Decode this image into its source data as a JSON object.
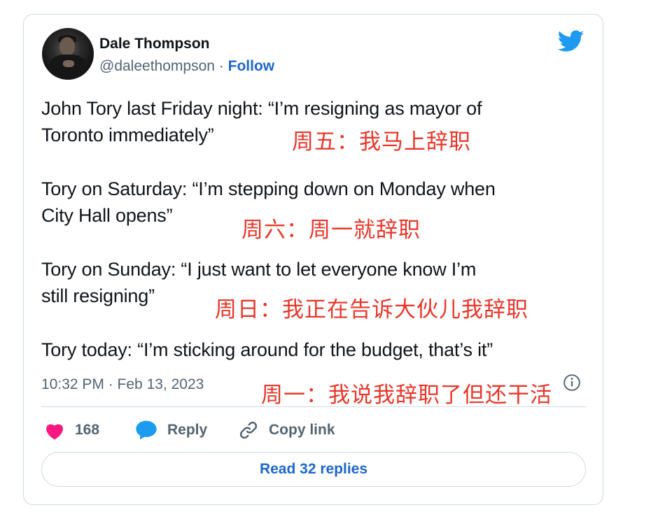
{
  "author": {
    "name": "Dale Thompson",
    "handle": "@daleethompson",
    "separator": "·",
    "follow_label": "Follow"
  },
  "tweet": {
    "lines": [
      "John Tory last Friday night: “I’m resigning as mayor of",
      "Toronto immediately”",
      "Tory on Saturday: “I’m stepping down on Monday when",
      "City Hall opens”",
      "Tory on Sunday: “I just want to let everyone know I’m",
      "still resigning”",
      "Tory today: “I’m sticking around for the budget, that’s it”"
    ],
    "timestamp": "10:32 PM · Feb 13, 2023"
  },
  "annotations": [
    "周五：我马上辞职",
    "周六：周一就辞职",
    "周日：我正在告诉大伙儿我辞职",
    "周一：我说我辞职了但还干活"
  ],
  "actions": {
    "like_count": "168",
    "reply_label": "Reply",
    "copy_link_label": "Copy link",
    "read_replies_label": "Read 32 replies"
  },
  "colors": {
    "text": "#0f1419",
    "muted": "#536471",
    "link_blue": "#1d67c9",
    "twitter_blue": "#1d9bf0",
    "heart": "#f91880",
    "annotation_red": "#e8362a",
    "border": "#cfd9de"
  },
  "icons": [
    "twitter-bird-icon",
    "info-icon",
    "heart-icon",
    "reply-bubble-icon",
    "link-icon"
  ]
}
